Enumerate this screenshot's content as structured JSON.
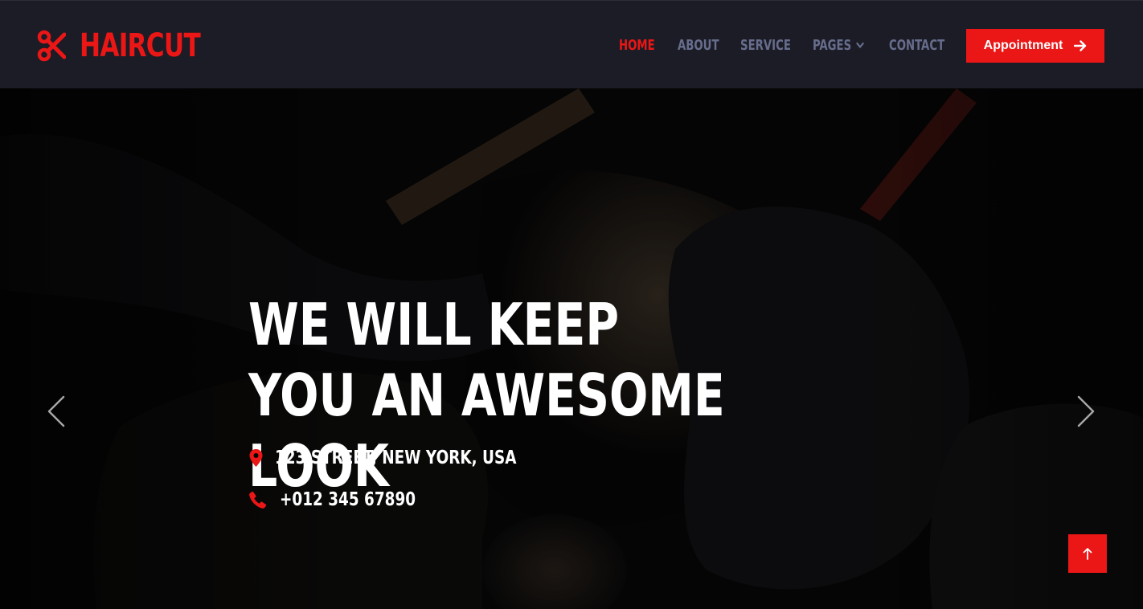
{
  "brand": {
    "name": "HAIRCUT",
    "icon": "scissors-icon",
    "color": "#eb1616"
  },
  "nav": {
    "items": [
      {
        "label": "HOME",
        "active": true
      },
      {
        "label": "ABOUT",
        "active": false
      },
      {
        "label": "SERVICE",
        "active": false
      },
      {
        "label": "PAGES",
        "active": false,
        "dropdown": true
      },
      {
        "label": "CONTACT",
        "active": false
      }
    ],
    "cta_label": "Appointment",
    "cta_icon": "arrow-right-icon"
  },
  "hero": {
    "title": "WE WILL KEEP YOU AN AWESOME LOOK",
    "address": "123 STREET, NEW YORK, USA",
    "address_icon": "map-marker-icon",
    "phone": "+012 345 67890",
    "phone_icon": "phone-icon"
  },
  "carousel": {
    "prev_icon": "chevron-left-icon",
    "next_icon": "chevron-right-icon"
  },
  "back_to_top_icon": "arrow-up-icon",
  "colors": {
    "accent": "#eb1616",
    "navbar_bg": "#1b1c25",
    "nav_text": "#676d8c",
    "hero_text": "#ffffff"
  }
}
